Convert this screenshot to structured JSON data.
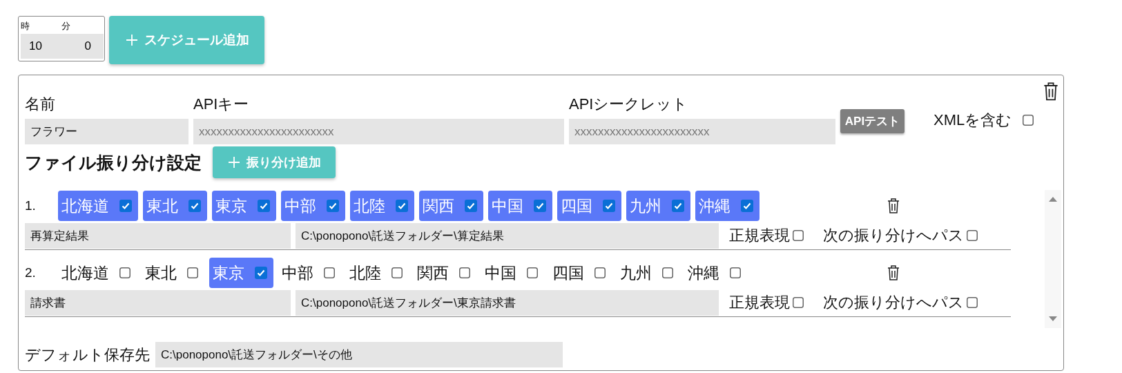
{
  "schedule": {
    "hour_label": "時",
    "minute_label": "分",
    "hour": "10",
    "minute": "0"
  },
  "add_schedule_button": {
    "label": "スケジュール追加"
  },
  "card": {
    "name_label": "名前",
    "name_value": "フラワー",
    "api_key_label": "APIキー",
    "api_key_placeholder": "xxxxxxxxxxxxxxxxxxxxxxx",
    "api_secret_label": "APIシークレット",
    "api_secret_placeholder": "xxxxxxxxxxxxxxxxxxxxxxx",
    "api_test_button": "APIテスト",
    "include_xml": {
      "label": "XMLを含む",
      "checked": false
    },
    "section_title": "ファイル振り分け設定",
    "add_rule_button": {
      "label": "振り分け追加"
    },
    "rules": [
      {
        "number": "1.",
        "regions": [
          {
            "label": "北海道",
            "checked": true
          },
          {
            "label": "東北",
            "checked": true
          },
          {
            "label": "東京",
            "checked": true
          },
          {
            "label": "中部",
            "checked": true
          },
          {
            "label": "北陸",
            "checked": true
          },
          {
            "label": "関西",
            "checked": true
          },
          {
            "label": "中国",
            "checked": true
          },
          {
            "label": "四国",
            "checked": true
          },
          {
            "label": "九州",
            "checked": true
          },
          {
            "label": "沖縄",
            "checked": true
          }
        ],
        "name": "再算定結果",
        "path": "C:\\ponopono\\託送フォルダー\\算定結果",
        "regex": {
          "label": "正規表現",
          "checked": false
        },
        "pass_next": {
          "label": "次の振り分けへパス",
          "checked": false
        }
      },
      {
        "number": "2.",
        "regions": [
          {
            "label": "北海道",
            "checked": false
          },
          {
            "label": "東北",
            "checked": false
          },
          {
            "label": "東京",
            "checked": true
          },
          {
            "label": "中部",
            "checked": false
          },
          {
            "label": "北陸",
            "checked": false
          },
          {
            "label": "関西",
            "checked": false
          },
          {
            "label": "中国",
            "checked": false
          },
          {
            "label": "四国",
            "checked": false
          },
          {
            "label": "九州",
            "checked": false
          },
          {
            "label": "沖縄",
            "checked": false
          }
        ],
        "name": "請求書",
        "path": "C:\\ponopono\\託送フォルダー\\東京請求書",
        "regex": {
          "label": "正規表現",
          "checked": false
        },
        "pass_next": {
          "label": "次の振り分けへパス",
          "checked": false
        }
      }
    ],
    "default_destination": {
      "label": "デフォルト保存先",
      "value": "C:\\ponopono\\託送フォルダー\\その他"
    }
  }
}
